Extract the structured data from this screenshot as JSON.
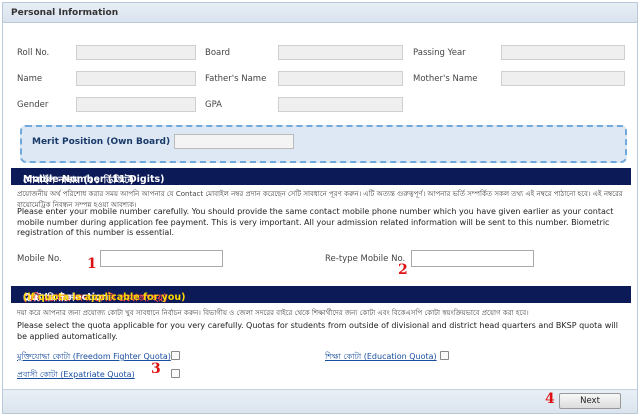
{
  "panel": {
    "title": "Personal Information"
  },
  "fields": {
    "roll_no": "Roll No.",
    "board": "Board",
    "passing_year": "Passing Year",
    "name": "Name",
    "fathers_name": "Father's Name",
    "mothers_name": "Mother's Name",
    "gender": "Gender",
    "gpa": "GPA"
  },
  "merit": {
    "label": "Merit Position (Own Board)"
  },
  "mobile_section": {
    "header_bn": "মোবাইল নাম্বার (১১ ডিজিট)",
    "header_en": "Mobile Number (11 Digits)",
    "instruction_bn": "প্রয়োজনীয় অর্থ পরিশোধ করার সময় আপনি আপনার যে Contact মোবাইল নম্বর প্রদান করেছেন সেটি সাবধানে পূরণ করুন। এটি অত্যন্ত গুরুত্বপূর্ণ। আপনার ভর্তি সম্পর্কিত সকল তথ্য এই নম্বরে পাঠানো হবে। এই নম্বরের বায়োমেট্রিক নিবন্ধন সম্পন্ন হওয়া আবশ্যক।",
    "instruction_en": "Please enter your mobile number carefully. You should provide the same contact mobile phone number which you have given earlier as your contact mobile number during application fee payment. This is very important. All your admission related information will be sent to this number. Biometric registration of this number is essential.",
    "mobile_label": "Mobile No.",
    "retype_label": "Re-type Mobile No.",
    "marker_1": "1",
    "marker_2": "2"
  },
  "quota_section": {
    "header_bn": "কোটা নির্বাচন",
    "header_bn_red": "(যদি তোমার জন্য কোটা প্রযোজ্য হয়)",
    "header_en": "Quota Selection",
    "header_en_yellow": "(if quota is applicable for you)",
    "instruction_bn": "দয়া করে আপনার জন্য প্রযোজ্য কোটা খুব সাবধানে নির্বাচন করুন। বিভাগীয় ও জেলা সদরের বাইরে থেকে শিক্ষার্থীদের জন্য কোটা এবং বিকেএসপি কোটা স্বয়ংক্রিয়ভাবে প্রয়োগ করা হবে।",
    "instruction_en": "Please select the quota applicable for you very carefully. Quotas for students from outside of divisional and district head quarters and BKSP quota will be applied automatically.",
    "ff_quota": "মুক্তিযোদ্ধা কোটা (Freedom Fighter Quota)",
    "edu_quota": "শিক্ষা কোটা (Education Quota)",
    "exp_quota": "প্রবাসী কোটা (Expatriate Quota)",
    "marker_3": "3"
  },
  "footer": {
    "next_label": "Next",
    "marker_4": "4"
  }
}
